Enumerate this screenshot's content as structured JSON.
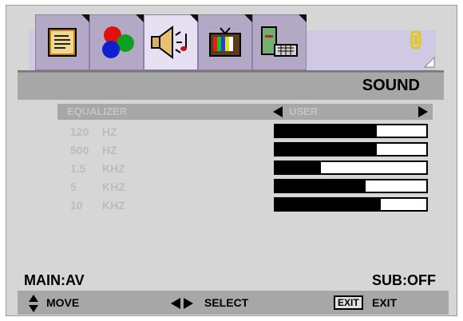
{
  "header": {
    "title": "SOUND"
  },
  "tabs": [
    {
      "name": "picture-tab",
      "icon": "document-icon"
    },
    {
      "name": "color-tab",
      "icon": "rgb-balls-icon"
    },
    {
      "name": "sound-tab",
      "icon": "speaker-icon",
      "active": true
    },
    {
      "name": "tv-tab",
      "icon": "tv-icon"
    },
    {
      "name": "setup-tab",
      "icon": "computer-icon"
    }
  ],
  "preset": {
    "label": "EQUALIZER",
    "value": "USER"
  },
  "equalizer": [
    {
      "freq": "120",
      "unit": "HZ",
      "level": 0.67
    },
    {
      "freq": "500",
      "unit": "HZ",
      "level": 0.67
    },
    {
      "freq": "1.5",
      "unit": "KHZ",
      "level": 0.3
    },
    {
      "freq": "5",
      "unit": "KHZ",
      "level": 0.6
    },
    {
      "freq": "10",
      "unit": "KHZ",
      "level": 0.7
    }
  ],
  "status": {
    "main": "MAIN:AV",
    "sub": "SUB:OFF"
  },
  "footer": {
    "move": "MOVE",
    "select": "SELECT",
    "exit_key": "EXIT",
    "exit": "EXIT"
  },
  "colors": {
    "background": "#d6d6d6",
    "header": "#a7a7a7",
    "tab": "#b3a9c7",
    "active_tab": "#e6e0f2"
  }
}
